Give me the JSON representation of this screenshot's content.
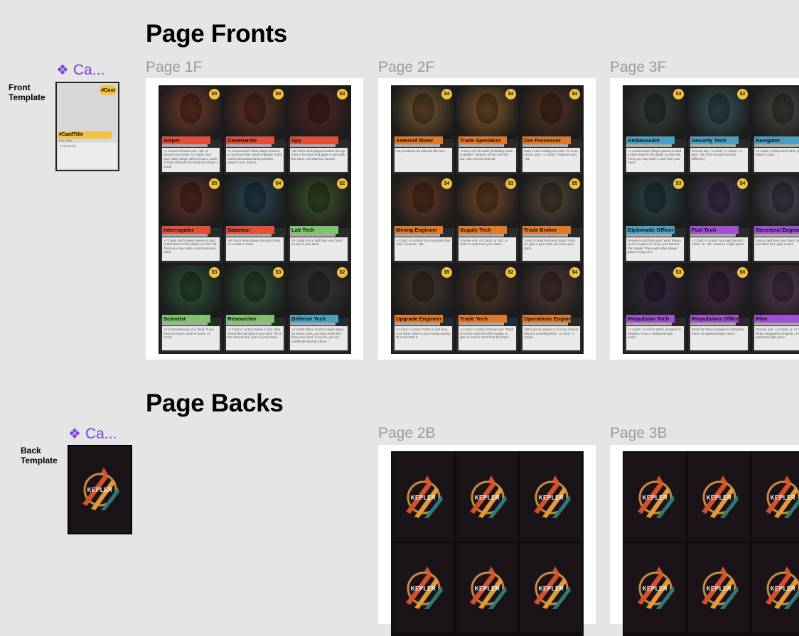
{
  "sections": {
    "fronts_title": "Page Fronts",
    "backs_title": "Page Backs"
  },
  "templates": {
    "front_label": "Front Template",
    "back_label": "Back Template",
    "component_label": "Ca...",
    "component_icon": "component-diamond-icon",
    "front_cost": "#Cost",
    "front_title": "#CardTitle",
    "front_type": "#CardType",
    "front_body": "#CardBody",
    "accent": "#7b3fe0"
  },
  "front_pages": [
    {
      "label": "Page 1F",
      "cards": [
        {
          "title": "Sniper",
          "cost": "$5",
          "color": "#e0503a",
          "art": "#7a3a2a",
          "text": "+1 Actions Choose one: +$2, or discard your hand, +4 Cards, and each other player with at least 5 cards in hand discards his hand and draws 4 cards."
        },
        {
          "title": "Commando",
          "cost": "$6",
          "color": "#e0503a",
          "art": "#6b3526",
          "text": "+1 Actions Each other player trashes a card from their hand randomly. If this card is discarded during another player's turn, draw 2."
        },
        {
          "title": "Spy",
          "cost": "$3",
          "color": "#e0503a",
          "art": "#5a2520",
          "text": "+$2 Each other player trashes the top card of his deck and gains a card with the same cost that you choose."
        },
        {
          "title": "Interrogator",
          "cost": "$5",
          "color": "#e0503a",
          "art": "#6a3326",
          "text": "+2 Cards Each player passes a card in their hand to the player on their left. Then you may trash a card from your hand."
        },
        {
          "title": "Saboteur",
          "cost": "$4",
          "color": "#e0503a",
          "art": "#2a4a5a",
          "text": "+$2 Each other player discards down to 3 cards in hand."
        },
        {
          "title": "Lab Tech",
          "cost": "$2",
          "color": "#7fc46a",
          "art": "#3d5a2a",
          "text": "+3 Cards Put a card from your hand on top of your deck."
        },
        {
          "title": "Scientist",
          "cost": "$3",
          "color": "#7fc46a",
          "art": "#2f5a3a",
          "text": "+2 Actions Reveal your hand. If you have no Action cards in hand, +3 Cards."
        },
        {
          "title": "Researcher",
          "cost": "$3",
          "color": "#7fc46a",
          "art": "#345a3c",
          "text": "+1 Card +1 Action Name a card, then reveal the top card of your deck. If it is the named card, put it in your hand."
        },
        {
          "title": "Defense Tech",
          "cost": "$2",
          "color": "#4aa0c0",
          "art": "#3a3a40",
          "text": "+2 Cards When another player plays an Attack card, you may reveal this from your hand. If you do, you are unaffected by that Attack."
        }
      ]
    },
    {
      "label": "Page 2F",
      "cards": [
        {
          "title": "Asteroid Miner",
          "cost": "$4",
          "color": "#e07a2a",
          "art": "#7a5a30",
          "text": "Iron produces an extra $1 this turn."
        },
        {
          "title": "Trade Specialist",
          "cost": "$4",
          "color": "#e07a2a",
          "art": "#8a5a2a",
          "text": "+1 Buy +$1 All cards (including cards in players' hands) cost $1 less this turn, but not less than $0."
        },
        {
          "title": "Ore Processor",
          "cost": "$4",
          "color": "#e07a2a",
          "art": "#5a3320",
          "text": "Gain a card costing up to $4. If it is an Action card, +1 Action. Treasure card, +$1."
        },
        {
          "title": "Mining Engineer",
          "cost": "$4",
          "color": "#e07a2a",
          "art": "#6a3a22",
          "text": "+1 Card +2 Actions You may trash this card. If you do, +$2."
        },
        {
          "title": "Supply Tech",
          "cost": "$3",
          "color": "#e07a2a",
          "art": "#7a4a28",
          "text": "Choose one: +2 Cards; or +$2; or trash 2 cards from your hand."
        },
        {
          "title": "Trade Broker",
          "cost": "$5",
          "color": "#e07a2a",
          "art": "#5a4a3a",
          "text": "Trash 2 cards from your hand. If you do, gain a gold card, put it into your hand."
        },
        {
          "title": "Upgrade Engineer",
          "cost": "$5",
          "color": "#e07a2a",
          "art": "#4a3a30",
          "text": "+1 Card +1 Action Trash a card from your hand. Gain a card costing exactly $1 more than it."
        },
        {
          "title": "Trade Tech",
          "cost": "$2",
          "color": "#e07a2a",
          "art": "#5a3a28",
          "text": "+1 Card +1 Action Choose one: Trash an Action card from the Supply, or gain an Action Card from the trash."
        },
        {
          "title": "Operations Engineer",
          "cost": "$4",
          "color": "#e07a2a",
          "art": "#5a3a3a",
          "text": "+$2 If you've played 3 or more Actions this turn (counting this): +1 Card, +1 Action."
        }
      ]
    },
    {
      "label": "Page 3F",
      "cards": [
        {
          "title": "Ambassador",
          "cost": "$3",
          "color": "#4aa0c0",
          "art": "#3a4440",
          "text": "+1 Actions Each player passes a card in their hand to the player on their left. Then you may trash a card from your hand."
        },
        {
          "title": "Security Tech",
          "cost": "$2",
          "color": "#4aa0c0",
          "art": "#3a5a60",
          "text": "Choose two: +1 Card; +1 Action; +1 Buy; +$1 (The choices must be different.)"
        },
        {
          "title": "Navigator",
          "cost": "$4",
          "color": "#4aa0c0",
          "art": "#4a4a44",
          "text": "+2 Cards +1 Buy Each other player draws a card."
        },
        {
          "title": "Diplomatic Officer",
          "cost": "$3",
          "color": "#4aa0c0",
          "art": "#2a4a50",
          "text": "Reveal a card from your hand. Return up to 2 copies of it from your hand to the Supply. Then each other player gains a copy of it."
        },
        {
          "title": "Fuel Tech",
          "cost": "$4",
          "color": "#a050d0",
          "art": "#4a3a5a",
          "text": "+1 Card +1 Action You may Discard 2 cards, for +$2. Advance 1 light years."
        },
        {
          "title": "Structural Engineer",
          "cost": "$4",
          "color": "#a050d0",
          "art": "#4a4a5a",
          "text": "Gain a card from your hand. When you finish this, gain a card."
        },
        {
          "title": "Propulsion Tech",
          "cost": "$3",
          "color": "#a050d0",
          "art": "#3a2a4a",
          "text": "+1 Cards +1 Action When assigned to Engines, move 3 additional light years."
        },
        {
          "title": "Propulsions Officer",
          "cost": "$6",
          "color": "#a050d0",
          "art": "#4a2a4a",
          "text": "Worth $2 When assigned to Engines, move 10 additional light years."
        },
        {
          "title": "Pilot",
          "cost": "$5",
          "color": "#a050d0",
          "art": "#5a3a5a",
          "text": "Choose one: +3 Cards; or +2 Actions. When assigned to Engines, move 5 additional light years."
        }
      ]
    }
  ],
  "back_pages": [
    {
      "label": "Page 2B",
      "logo_text": "KEPLER"
    },
    {
      "label": "Page 3B",
      "logo_text": "KEPLER"
    }
  ]
}
